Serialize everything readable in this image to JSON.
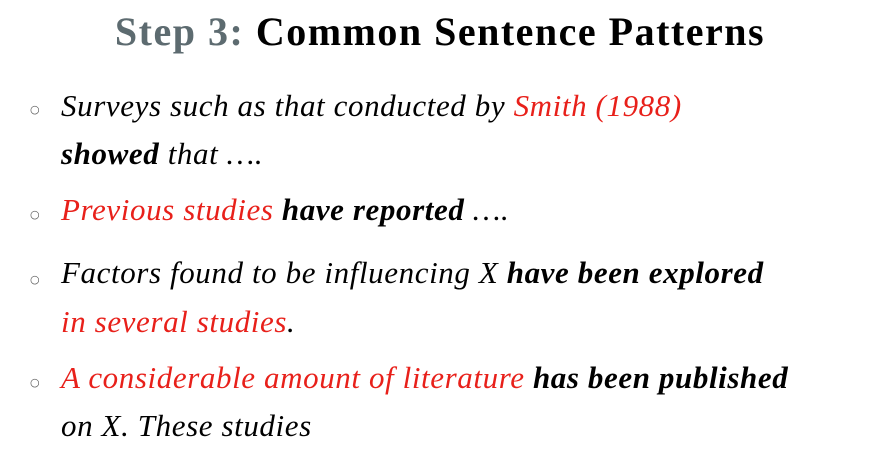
{
  "title": {
    "step": "Step 3:",
    "main": "Common Sentence Patterns"
  },
  "bullets": [
    {
      "p1": "Surveys such as that conducted by ",
      "p2": "Smith (1988)",
      "p3": "showed",
      "p4": " that …."
    },
    {
      "p1": "Previous studies",
      "p2": " ",
      "p3": "have reported",
      "p4": " …."
    },
    {
      "p1": "Factors found to be influencing X ",
      "p2": "have been explored",
      "p3": "in several studies",
      "p4": "."
    },
    {
      "p1": "A considerable amount of literature",
      "p2": " ",
      "p3": "has been published",
      "p4": "on X. These studies"
    }
  ],
  "colors": {
    "highlight": "#e8201a",
    "step_label": "#5d6b70",
    "text": "#000000"
  },
  "bullet_icon": "hollow-circle-icon"
}
